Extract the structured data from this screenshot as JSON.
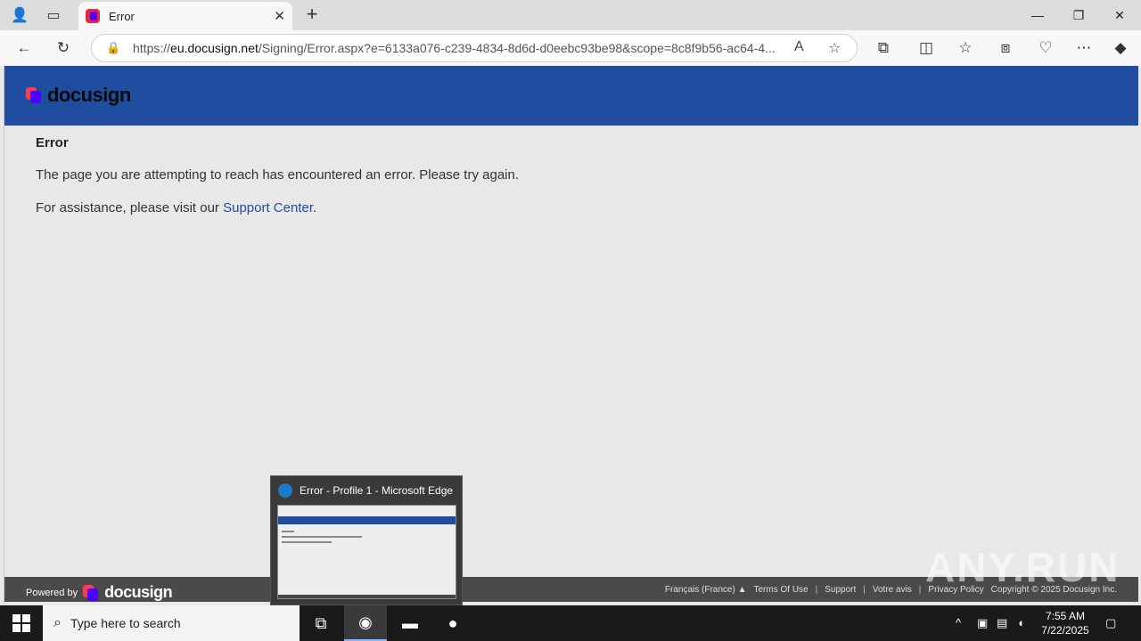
{
  "browser": {
    "tab_title": "Error",
    "url_prefix": "https://",
    "url_domain": "eu.docusign.net",
    "url_rest": "/Signing/Error.aspx?e=6133a076-c239-4834-8d6d-d0eebc93be98&scope=8c8f9b56-ac64-4..."
  },
  "page": {
    "logo": "docusign",
    "error_title": "Error",
    "error_message": "The page you are attempting to reach has encountered an error. Please try again.",
    "assist_prefix": "For assistance, please visit our",
    "assist_link": "Support Center",
    "assist_suffix": "."
  },
  "footer": {
    "powered_by": "Powered by",
    "logo": "docusign",
    "language": "Français (France) ▲",
    "links": [
      "Terms Of Use",
      "Support",
      "Votre avis",
      "Privacy Policy"
    ],
    "copyright": "Copyright © 2025 Docusign Inc."
  },
  "preview": {
    "title": "Error - Profile 1 - Microsoft Edge"
  },
  "taskbar": {
    "search_placeholder": "Type here to search",
    "time": "7:55 AM",
    "date": "7/22/2025"
  },
  "watermark": "ANY.RUN"
}
